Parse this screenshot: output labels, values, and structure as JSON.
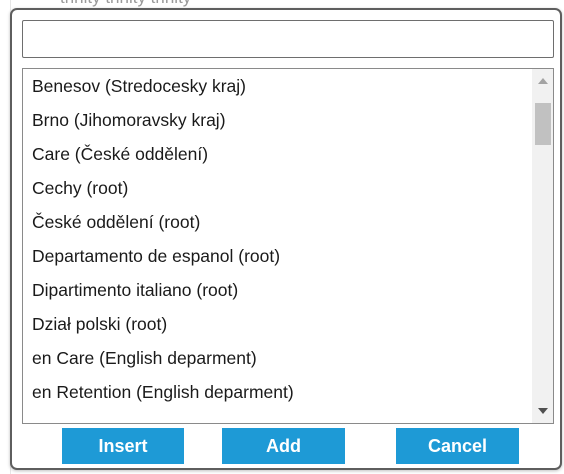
{
  "background": {
    "partial_text": "trinity trinity trinity"
  },
  "search": {
    "value": "",
    "placeholder": ""
  },
  "list": {
    "items": [
      "Benesov (Stredocesky kraj)",
      "Brno (Jihomoravsky kraj)",
      "Care (České oddělení)",
      "Cechy (root)",
      "České oddělení (root)",
      "Departamento de espanol (root)",
      "Dipartimento italiano (root)",
      "Dział polski (root)",
      "en Care (English deparment)",
      "en Retention (English deparment)"
    ]
  },
  "scrollbar": {
    "up_icon": "chevron-up-icon",
    "down_icon": "chevron-down-icon"
  },
  "buttons": {
    "insert_label": "Insert",
    "add_label": "Add",
    "cancel_label": "Cancel"
  },
  "colors": {
    "button_bg": "#1e9ad6",
    "button_text": "#ffffff",
    "dialog_border": "#5e5e5e"
  }
}
